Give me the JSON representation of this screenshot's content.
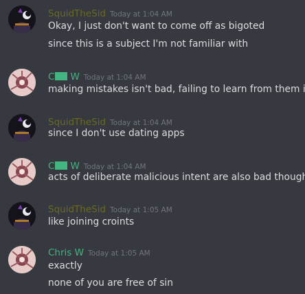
{
  "colors": {
    "background": "#36393f",
    "squid_name": "#6b6a1f",
    "chris_name": "#43b581",
    "text": "#dcddde",
    "timestamp": "#72767d",
    "redaction": "#43b581"
  },
  "messages": [
    {
      "author": "SquidTheSid",
      "timestamp": "Today at 1:04 AM",
      "lines": [
        "Okay, I just don't want to come off as bigoted",
        "since this is a subject I'm not familiar with"
      ]
    },
    {
      "author_first": "C",
      "author_last": "W",
      "timestamp": "Today at 1:04 AM",
      "lines": [
        "making mistakes isn't bad, failing to learn from them is"
      ]
    },
    {
      "author": "SquidTheSid",
      "timestamp": "Today at 1:04 AM",
      "lines": [
        "since I don't use dating apps"
      ]
    },
    {
      "author_first": "C",
      "author_last": "W",
      "timestamp": "Today at 1:04 AM",
      "lines": [
        "acts of deliberate malicious intent are also bad though"
      ]
    },
    {
      "author": "SquidTheSid",
      "timestamp": "Today at 1:05 AM",
      "lines": [
        "like joining croints"
      ]
    },
    {
      "author": "Chris W",
      "timestamp": "Today at 1:05 AM",
      "lines": [
        "exactly",
        "none of you are free of sin"
      ]
    }
  ]
}
